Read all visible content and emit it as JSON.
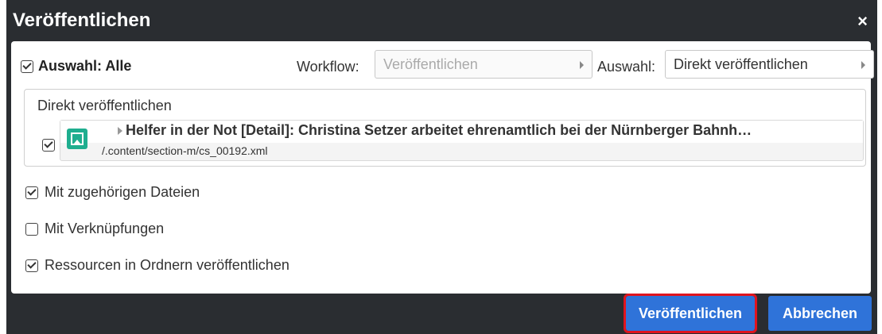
{
  "dialog": {
    "title": "Veröffentlichen",
    "close_label": "×"
  },
  "selection": {
    "select_all_label": "Auswahl: Alle",
    "select_all_checked": true,
    "workflow_label": "Workflow:",
    "workflow_value": "Veröffentlichen",
    "auswahl_label": "Auswahl:",
    "auswahl_value": "Direkt veröffentlichen"
  },
  "group": {
    "title": "Direkt veröffentlichen",
    "items": [
      {
        "checked": true,
        "icon": "resource-image-icon",
        "title": "Helfer in der Not [Detail]: Christina Setzer arbeitet ehrenamtlich bei der Nürnberger Bahnh…",
        "path": "/.content/section-m/cs_00192.xml"
      }
    ]
  },
  "options": [
    {
      "label": "Mit zugehörigen Dateien",
      "checked": true
    },
    {
      "label": "Mit Verknüpfungen",
      "checked": false
    },
    {
      "label": "Ressourcen in Ordnern veröffentlichen",
      "checked": true
    }
  ],
  "buttons": {
    "publish_label": "Veröffentlichen",
    "cancel_label": "Abbrechen"
  },
  "colors": {
    "dialog_bg": "#2a2d31",
    "button_blue": "#2f73d9",
    "highlight_red": "#e0141e",
    "icon_green": "#1fae8f"
  }
}
